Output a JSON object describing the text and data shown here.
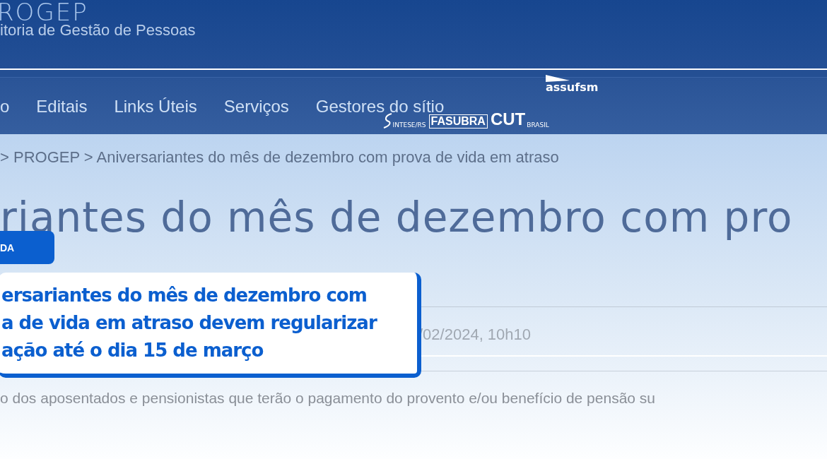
{
  "header": {
    "logo": "ROGEP",
    "subtitle": "itoria de Gestão de Pessoas"
  },
  "nav": {
    "items": [
      "o",
      "Editais",
      "Links Úteis",
      "Serviços",
      "Gestores do sítio"
    ]
  },
  "logos": {
    "assufsm": "assufsm",
    "sintese": "INTESE/RS",
    "fasubra": "FASUBRA",
    "cut": "CUT",
    "cut_country": "BRASIL"
  },
  "breadcrumb": "> PROGEP > Aniversariantes do mês de dezembro com prova de vida em atraso",
  "title": "riantes do mês de dezembro com pro",
  "date": "/02/2024, 10h10",
  "body": "o dos aposentados e pensionistas que terão o pagamento do provento e/ou benefício de pensão su",
  "overlay": {
    "badge": "DA",
    "headline": [
      "ersariantes do mês de dezembro com",
      "a de vida em atraso devem regularizar",
      "ação até o dia 15 de março"
    ]
  }
}
